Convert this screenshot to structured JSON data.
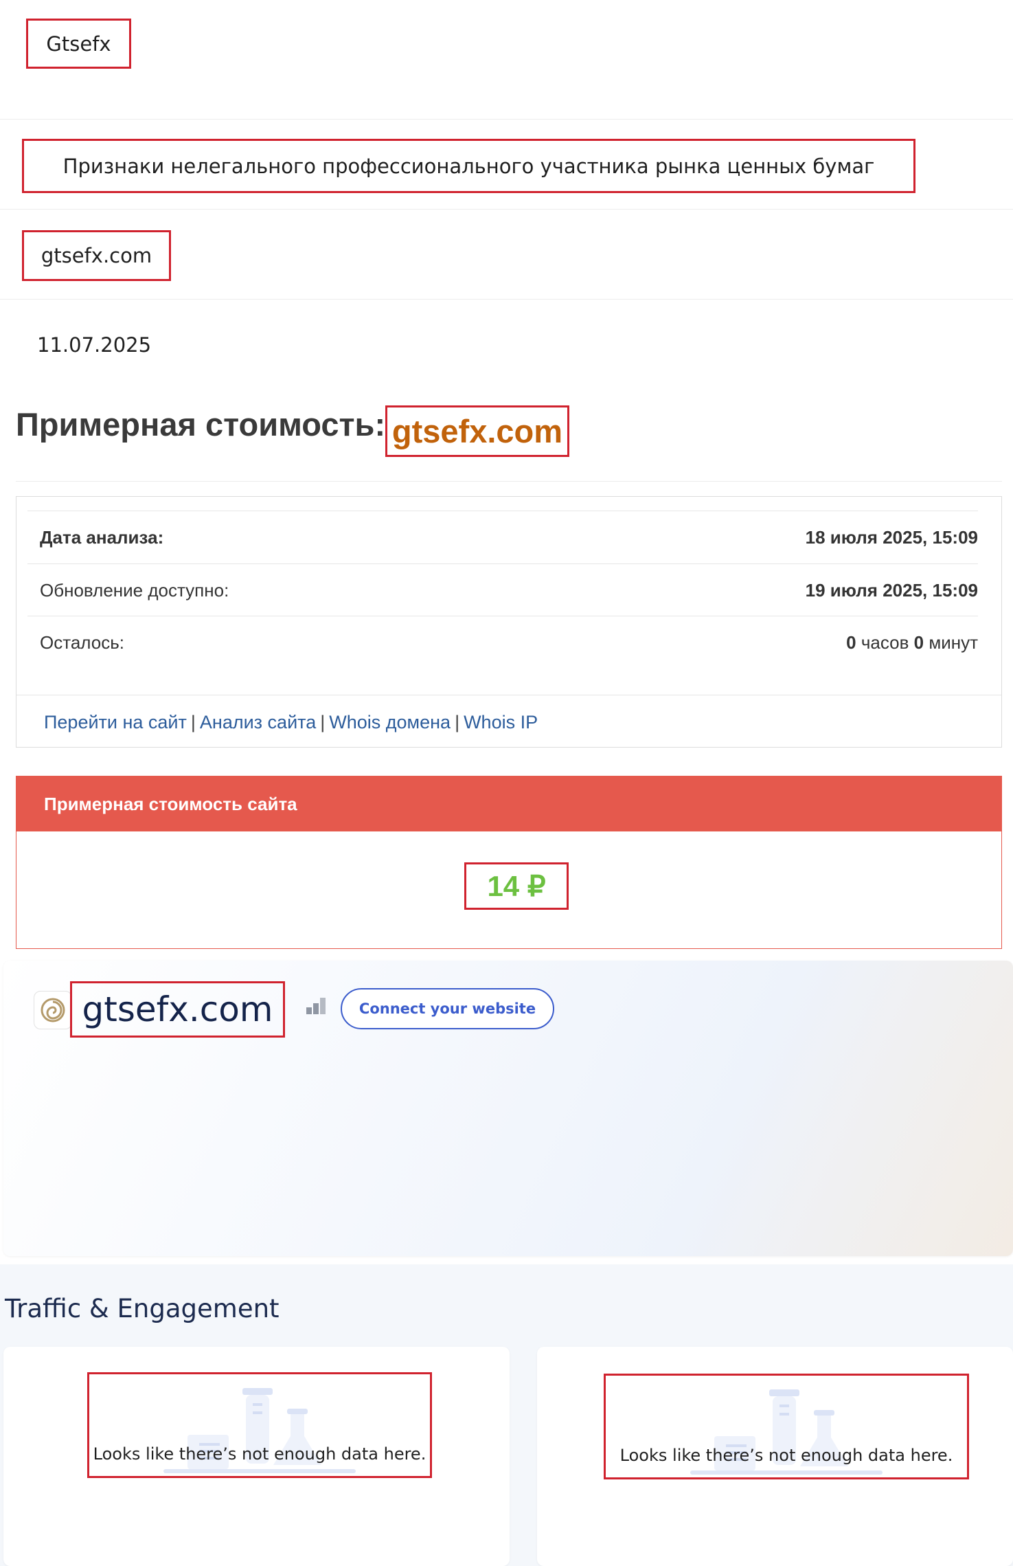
{
  "header": {
    "name": "Gtsefx",
    "category": "Признаки нелегального профессионального участника рынка ценных бумаг",
    "domain": "gtsefx.com",
    "date": "11.07.2025"
  },
  "cost_section": {
    "heading": "Примерная стоимость:",
    "domain": "gtsefx.com"
  },
  "info_table": {
    "rows": [
      {
        "label": "Дата анализа:",
        "value": "18 июля 2025, 15:09"
      },
      {
        "label": "Обновление доступно:",
        "value": "19 июля 2025, 15:09"
      },
      {
        "label": "Осталось:",
        "hours": "0",
        "hours_unit": " часов ",
        "minutes": "0",
        "minutes_unit": " минут"
      }
    ],
    "links": [
      "Перейти на сайт",
      "Анализ сайта",
      "Whois домена",
      "Whois IP"
    ],
    "separator": "|"
  },
  "cost_panel": {
    "title": "Примерная стоимость сайта",
    "price": "14 ₽"
  },
  "site_card": {
    "domain": "gtsefx.com",
    "connect_button": "Connect your website"
  },
  "traffic": {
    "title": "Traffic & Engagement",
    "cards": [
      {
        "empty_message": "Looks like there’s not enough data here."
      },
      {
        "empty_message": "Looks like there’s not enough data here."
      }
    ]
  },
  "colors": {
    "highlight_box": "#d0222e",
    "cost_domain": "#c1620b",
    "panel_header": "#e5594d",
    "price": "#6cc040",
    "link": "#2c5c9b",
    "connect_button": "#3b5ccc"
  }
}
